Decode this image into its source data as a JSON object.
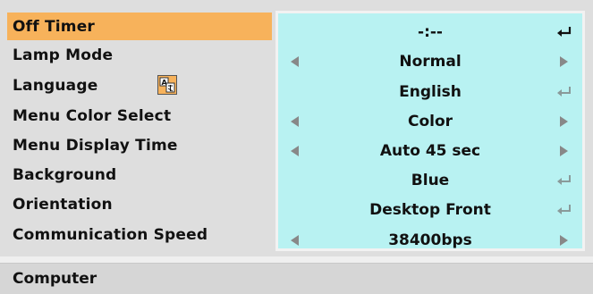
{
  "menu": {
    "rows": [
      {
        "label": "Off Timer",
        "value": "-:--",
        "control": "enter-active",
        "selected": true
      },
      {
        "label": "Lamp Mode",
        "value": "Normal",
        "control": "arrows"
      },
      {
        "label": "Language",
        "value": "English",
        "control": "enter",
        "icon": "language-icon"
      },
      {
        "label": "Menu Color Select",
        "value": "Color",
        "control": "arrows"
      },
      {
        "label": "Menu Display Time",
        "value": "Auto 45 sec",
        "control": "arrows"
      },
      {
        "label": "Background",
        "value": "Blue",
        "control": "enter"
      },
      {
        "label": "Orientation",
        "value": "Desktop Front",
        "control": "enter"
      },
      {
        "label": "Communication Speed",
        "value": "38400bps",
        "control": "arrows"
      }
    ]
  },
  "footer": {
    "source": "Computer"
  },
  "colors": {
    "selected_row": "#f7b25b",
    "value_panel": "#b8f2f2",
    "background": "#dedede"
  }
}
